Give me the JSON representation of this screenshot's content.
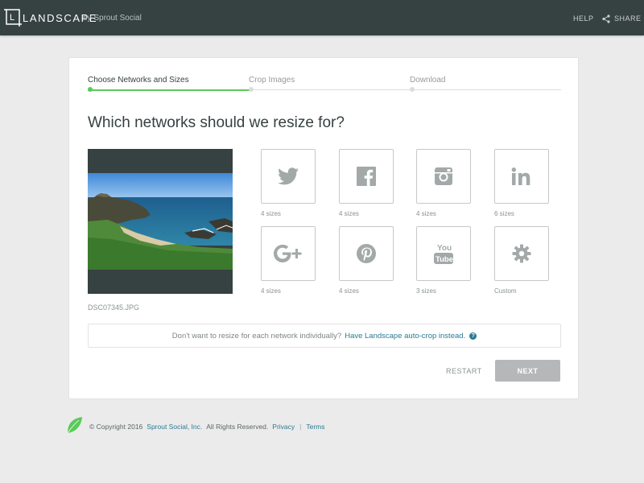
{
  "header": {
    "brand": "LANDSCAPE",
    "brand_logo_letter": "L",
    "by_line": "by Sprout Social",
    "help": "HELP",
    "share": "SHARE",
    "bg_color": "#364141"
  },
  "steps": [
    {
      "label": "Choose Networks and Sizes",
      "active": true
    },
    {
      "label": "Crop Images",
      "active": false
    },
    {
      "label": "Download",
      "active": false
    }
  ],
  "title": "Which networks should we resize for?",
  "image": {
    "filename": "DSC07345.JPG"
  },
  "networks": [
    {
      "name": "Twitter",
      "icon": "twitter-icon",
      "caption": "4 sizes"
    },
    {
      "name": "Facebook",
      "icon": "facebook-icon",
      "caption": "4 sizes"
    },
    {
      "name": "Instagram",
      "icon": "instagram-icon",
      "caption": "4 sizes"
    },
    {
      "name": "LinkedIn",
      "icon": "linkedin-icon",
      "caption": "6 sizes"
    },
    {
      "name": "Google+",
      "icon": "google-plus-icon",
      "caption": "4 sizes"
    },
    {
      "name": "Pinterest",
      "icon": "pinterest-icon",
      "caption": "4 sizes"
    },
    {
      "name": "YouTube",
      "icon": "youtube-icon",
      "caption": "3 sizes"
    },
    {
      "name": "Custom",
      "icon": "gear-icon",
      "caption": "Custom"
    }
  ],
  "notice": {
    "text": "Don't want to resize for each network individually?",
    "link": "Have Landscape auto-crop instead.",
    "help_glyph": "?"
  },
  "actions": {
    "restart": "RESTART",
    "next": "NEXT"
  },
  "footer": {
    "copyright": "© Copyright 2016",
    "company": "Sprout Social, Inc.",
    "rights": "All Rights Reserved.",
    "privacy": "Privacy",
    "separator": "|",
    "terms": "Terms"
  },
  "colors": {
    "accent_green": "#59cb59",
    "link_teal": "#2a7b93",
    "disabled_button": "#b4b8b8"
  }
}
